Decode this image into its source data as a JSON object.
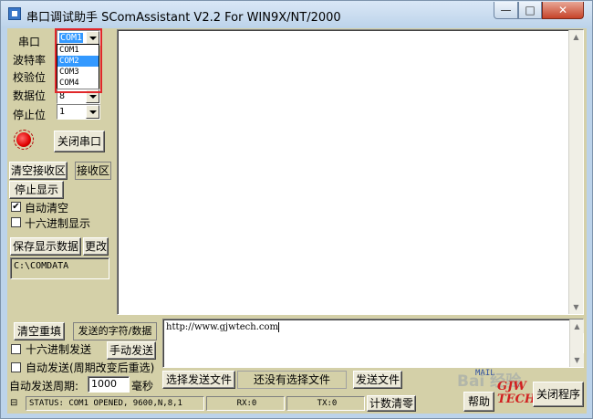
{
  "window": {
    "title": "串口调试助手 SComAssistant V2.2 For WIN9X/NT/2000",
    "controls": {
      "minimize": "—",
      "maximize": "□",
      "close": "✕"
    }
  },
  "settings": {
    "port_label": "串口",
    "baud_label": "波特率",
    "parity_label": "校验位",
    "databits_label": "数据位",
    "stopbits_label": "停止位",
    "port_value": "COM1",
    "databits_value": "8",
    "stopbits_value": "1",
    "port_options": [
      "COM1",
      "COM2",
      "COM3",
      "COM4"
    ],
    "port_highlighted": "COM2",
    "close_port_button": "关闭串口"
  },
  "receive": {
    "clear_button": "清空接收区",
    "area_label": "接收区",
    "stop_display_button": "停止显示",
    "auto_clear_label": "自动清空",
    "auto_clear_checked": true,
    "hex_display_label": "十六进制显示",
    "hex_display_checked": false,
    "save_data_button": "保存显示数据",
    "change_button": "更改",
    "save_path": "C:\\COMDATA"
  },
  "send": {
    "clear_resend_button": "清空重填",
    "chars_label": "发送的字符/数据",
    "hex_send_label": "十六进制发送",
    "hex_send_checked": false,
    "manual_send_button": "手动发送",
    "auto_send_label": "自动发送(周期改变后重选)",
    "auto_send_checked": false,
    "period_label": "自动发送周期:",
    "period_value": "1000",
    "period_unit": "毫秒",
    "send_text": "http://www.gjwtech.com",
    "select_file_button": "选择发送文件",
    "no_file_label": "还没有选择文件",
    "send_file_button": "发送文件"
  },
  "status": {
    "text": "STATUS: COM1 OPENED, 9600,N,8,1",
    "rx": "RX:0",
    "tx": "TX:0",
    "reset_counter_button": "计数清零",
    "help_button": "帮助",
    "close_program_button": "关闭程序"
  },
  "branding": {
    "logo_top": "GJW",
    "logo_bottom": "TECH",
    "mail_label": "MAIL",
    "watermark": "Bai 经验"
  },
  "icons": {
    "led": "red-led-icon",
    "checkmark": "✔"
  }
}
